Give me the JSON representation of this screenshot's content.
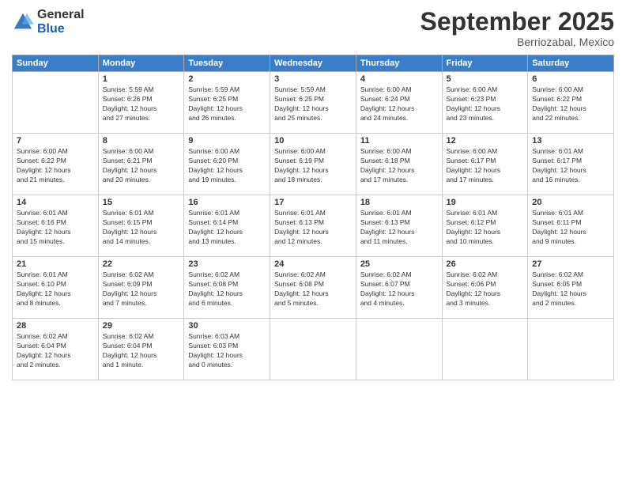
{
  "logo": {
    "general": "General",
    "blue": "Blue"
  },
  "header": {
    "month": "September 2025",
    "location": "Berriozabal, Mexico"
  },
  "days_of_week": [
    "Sunday",
    "Monday",
    "Tuesday",
    "Wednesday",
    "Thursday",
    "Friday",
    "Saturday"
  ],
  "weeks": [
    [
      {
        "num": "",
        "info": ""
      },
      {
        "num": "1",
        "info": "Sunrise: 5:59 AM\nSunset: 6:26 PM\nDaylight: 12 hours\nand 27 minutes."
      },
      {
        "num": "2",
        "info": "Sunrise: 5:59 AM\nSunset: 6:25 PM\nDaylight: 12 hours\nand 26 minutes."
      },
      {
        "num": "3",
        "info": "Sunrise: 5:59 AM\nSunset: 6:25 PM\nDaylight: 12 hours\nand 25 minutes."
      },
      {
        "num": "4",
        "info": "Sunrise: 6:00 AM\nSunset: 6:24 PM\nDaylight: 12 hours\nand 24 minutes."
      },
      {
        "num": "5",
        "info": "Sunrise: 6:00 AM\nSunset: 6:23 PM\nDaylight: 12 hours\nand 23 minutes."
      },
      {
        "num": "6",
        "info": "Sunrise: 6:00 AM\nSunset: 6:22 PM\nDaylight: 12 hours\nand 22 minutes."
      }
    ],
    [
      {
        "num": "7",
        "info": "Sunrise: 6:00 AM\nSunset: 6:22 PM\nDaylight: 12 hours\nand 21 minutes."
      },
      {
        "num": "8",
        "info": "Sunrise: 6:00 AM\nSunset: 6:21 PM\nDaylight: 12 hours\nand 20 minutes."
      },
      {
        "num": "9",
        "info": "Sunrise: 6:00 AM\nSunset: 6:20 PM\nDaylight: 12 hours\nand 19 minutes."
      },
      {
        "num": "10",
        "info": "Sunrise: 6:00 AM\nSunset: 6:19 PM\nDaylight: 12 hours\nand 18 minutes."
      },
      {
        "num": "11",
        "info": "Sunrise: 6:00 AM\nSunset: 6:18 PM\nDaylight: 12 hours\nand 17 minutes."
      },
      {
        "num": "12",
        "info": "Sunrise: 6:00 AM\nSunset: 6:17 PM\nDaylight: 12 hours\nand 17 minutes."
      },
      {
        "num": "13",
        "info": "Sunrise: 6:01 AM\nSunset: 6:17 PM\nDaylight: 12 hours\nand 16 minutes."
      }
    ],
    [
      {
        "num": "14",
        "info": "Sunrise: 6:01 AM\nSunset: 6:16 PM\nDaylight: 12 hours\nand 15 minutes."
      },
      {
        "num": "15",
        "info": "Sunrise: 6:01 AM\nSunset: 6:15 PM\nDaylight: 12 hours\nand 14 minutes."
      },
      {
        "num": "16",
        "info": "Sunrise: 6:01 AM\nSunset: 6:14 PM\nDaylight: 12 hours\nand 13 minutes."
      },
      {
        "num": "17",
        "info": "Sunrise: 6:01 AM\nSunset: 6:13 PM\nDaylight: 12 hours\nand 12 minutes."
      },
      {
        "num": "18",
        "info": "Sunrise: 6:01 AM\nSunset: 6:13 PM\nDaylight: 12 hours\nand 11 minutes."
      },
      {
        "num": "19",
        "info": "Sunrise: 6:01 AM\nSunset: 6:12 PM\nDaylight: 12 hours\nand 10 minutes."
      },
      {
        "num": "20",
        "info": "Sunrise: 6:01 AM\nSunset: 6:11 PM\nDaylight: 12 hours\nand 9 minutes."
      }
    ],
    [
      {
        "num": "21",
        "info": "Sunrise: 6:01 AM\nSunset: 6:10 PM\nDaylight: 12 hours\nand 8 minutes."
      },
      {
        "num": "22",
        "info": "Sunrise: 6:02 AM\nSunset: 6:09 PM\nDaylight: 12 hours\nand 7 minutes."
      },
      {
        "num": "23",
        "info": "Sunrise: 6:02 AM\nSunset: 6:08 PM\nDaylight: 12 hours\nand 6 minutes."
      },
      {
        "num": "24",
        "info": "Sunrise: 6:02 AM\nSunset: 6:08 PM\nDaylight: 12 hours\nand 5 minutes."
      },
      {
        "num": "25",
        "info": "Sunrise: 6:02 AM\nSunset: 6:07 PM\nDaylight: 12 hours\nand 4 minutes."
      },
      {
        "num": "26",
        "info": "Sunrise: 6:02 AM\nSunset: 6:06 PM\nDaylight: 12 hours\nand 3 minutes."
      },
      {
        "num": "27",
        "info": "Sunrise: 6:02 AM\nSunset: 6:05 PM\nDaylight: 12 hours\nand 2 minutes."
      }
    ],
    [
      {
        "num": "28",
        "info": "Sunrise: 6:02 AM\nSunset: 6:04 PM\nDaylight: 12 hours\nand 2 minutes."
      },
      {
        "num": "29",
        "info": "Sunrise: 6:02 AM\nSunset: 6:04 PM\nDaylight: 12 hours\nand 1 minute."
      },
      {
        "num": "30",
        "info": "Sunrise: 6:03 AM\nSunset: 6:03 PM\nDaylight: 12 hours\nand 0 minutes."
      },
      {
        "num": "",
        "info": ""
      },
      {
        "num": "",
        "info": ""
      },
      {
        "num": "",
        "info": ""
      },
      {
        "num": "",
        "info": ""
      }
    ]
  ]
}
